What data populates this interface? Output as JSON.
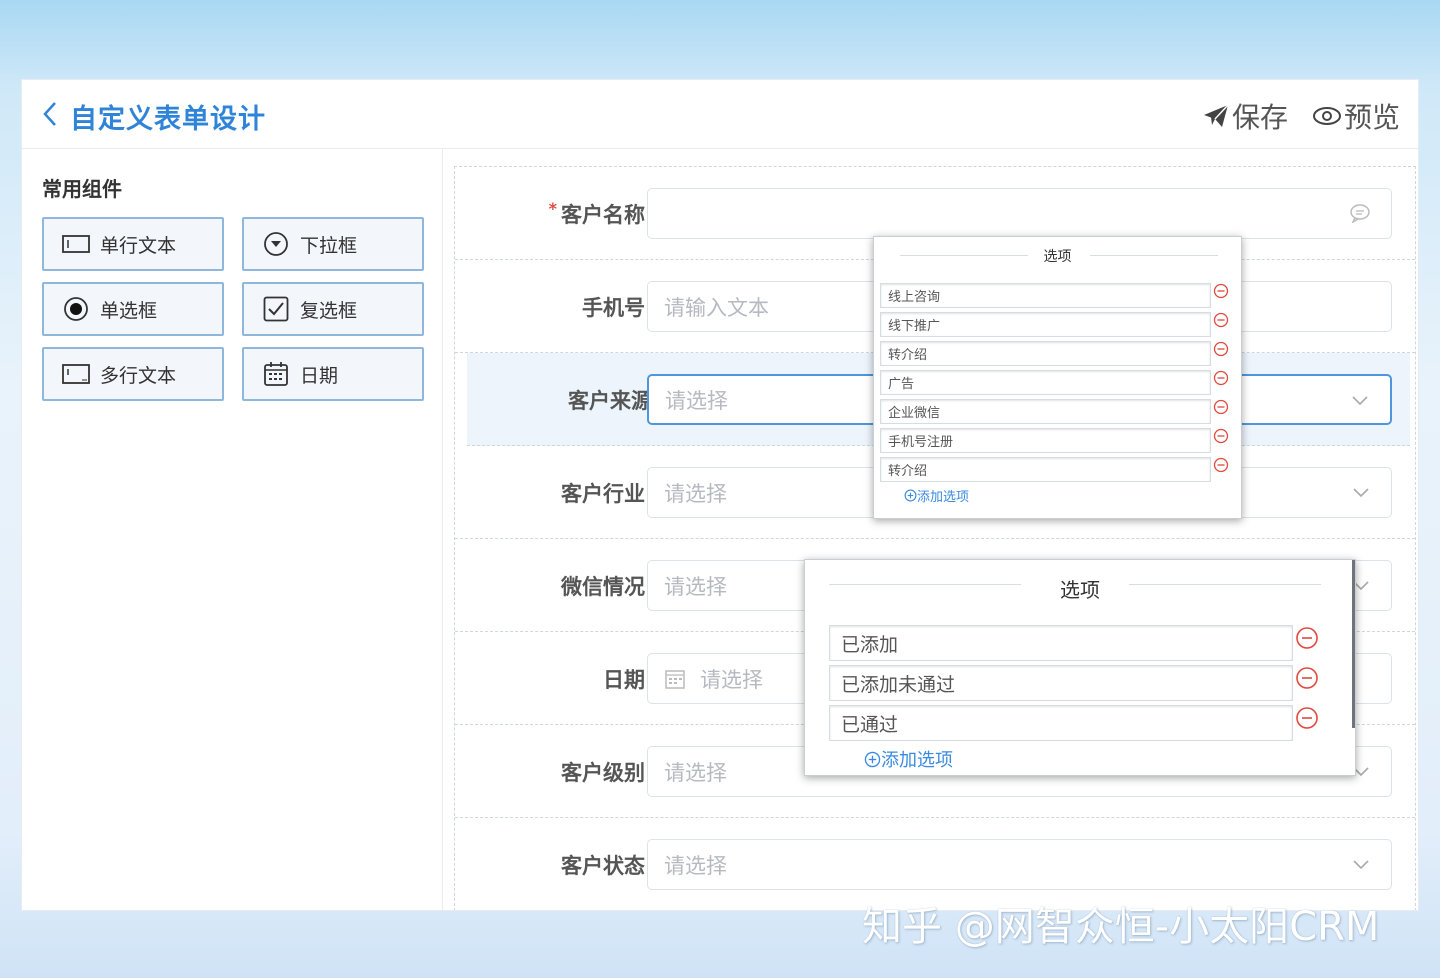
{
  "header": {
    "title": "自定义表单设计",
    "save_label": "保存",
    "preview_label": "预览"
  },
  "sidebar": {
    "title": "常用组件",
    "components": [
      {
        "label": "单行文本",
        "icon": "single-line-text-icon"
      },
      {
        "label": "下拉框",
        "icon": "dropdown-icon"
      },
      {
        "label": "单选框",
        "icon": "radio-icon"
      },
      {
        "label": "复选框",
        "icon": "checkbox-icon"
      },
      {
        "label": "多行文本",
        "icon": "multi-line-text-icon"
      },
      {
        "label": "日期",
        "icon": "calendar-icon"
      }
    ]
  },
  "form": {
    "fields": [
      {
        "label": "客户名称",
        "required": true,
        "type": "text",
        "value": "",
        "placeholder": ""
      },
      {
        "label": "手机号",
        "type": "text",
        "placeholder": "请输入文本"
      },
      {
        "label": "客户来源",
        "type": "select",
        "placeholder": "请选择",
        "active": true
      },
      {
        "label": "客户行业",
        "type": "select",
        "placeholder": "请选择"
      },
      {
        "label": "微信情况",
        "type": "select",
        "placeholder": "请选择"
      },
      {
        "label": "日期",
        "type": "date",
        "placeholder": "请选择"
      },
      {
        "label": "客户级别",
        "type": "select",
        "placeholder": "请选择"
      },
      {
        "label": "客户状态",
        "type": "select",
        "placeholder": "请选择"
      }
    ],
    "required_mark": "*"
  },
  "options_popup_source": {
    "title": "选项",
    "options": [
      "线上咨询",
      "线下推广",
      "转介绍",
      "广告",
      "企业微信",
      "手机号注册",
      "转介绍"
    ],
    "add_label": "添加选项"
  },
  "options_popup_wechat": {
    "title": "选项",
    "options": [
      "已添加",
      "已添加未通过",
      "已通过"
    ],
    "add_label": "添加选项"
  },
  "watermark": "知乎 @网智众恒-小太阳CRM",
  "colors": {
    "accent": "#2f84d8",
    "active_border": "#4f96dc",
    "remove": "#e2483d"
  }
}
